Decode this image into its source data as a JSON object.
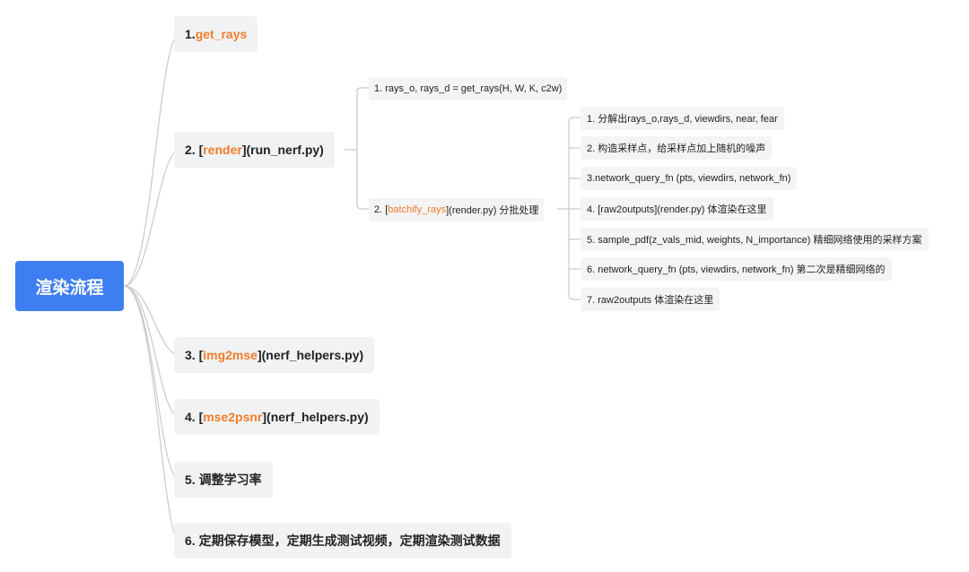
{
  "root": {
    "label": "渲染流程"
  },
  "steps": [
    {
      "prefix": "1.",
      "link": "get_rays",
      "suffix": ""
    },
    {
      "prefix": "2. [",
      "link": "render",
      "suffix": "](run_nerf.py)"
    },
    {
      "prefix": "3. [",
      "link": "img2mse",
      "suffix": "](nerf_helpers.py)"
    },
    {
      "prefix": "4. [",
      "link": "mse2psnr",
      "suffix": "](nerf_helpers.py)"
    },
    {
      "label": "5. 调整学习率"
    },
    {
      "label": "6. 定期保存模型，定期生成测试视频，定期渲染测试数据"
    }
  ],
  "render_children": [
    {
      "label": "1. rays_o, rays_d = get_rays(H, W, K, c2w)"
    },
    {
      "prefix": "2. [",
      "link": "batchify_rays",
      "suffix": "](render.py) 分批处理"
    }
  ],
  "batchify_children": [
    "1. 分解出rays_o,rays_d, viewdirs, near, fear",
    "2. 构造采样点，给采样点加上随机的噪声",
    "3.network_query_fn (pts, viewdirs, network_fn)",
    "4. [raw2outputs](render.py) 体渲染在这里",
    "5. sample_pdf(z_vals_mid, weights, N_importance) 精细网络使用的采样方案",
    "6. network_query_fn (pts, viewdirs, network_fn) 第二次是精细网络的",
    "7. raw2outputs 体渲染在这里"
  ],
  "colors": {
    "root_bg": "#3e7ef2",
    "link": "#f07c2a",
    "node_bg": "#f1f2f4",
    "line": "#c9c9c9"
  }
}
